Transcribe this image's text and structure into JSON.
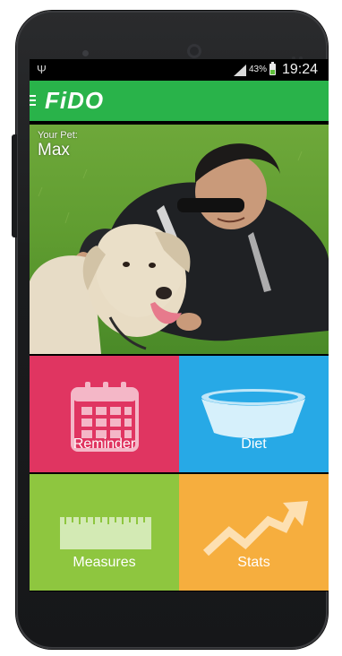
{
  "status_bar": {
    "battery_percent": "43%",
    "time": "19:24"
  },
  "app_bar": {
    "title": "FiDO"
  },
  "hero": {
    "caption": "Your Pet:",
    "pet_name": "Max"
  },
  "tiles": [
    {
      "label": "Reminder",
      "icon": "calendar-icon",
      "color": "#e03561"
    },
    {
      "label": "Diet",
      "icon": "bowl-icon",
      "color": "#27a9e6"
    },
    {
      "label": "Measures",
      "icon": "ruler-icon",
      "color": "#8ec63f"
    },
    {
      "label": "Stats",
      "icon": "trend-arrow-icon",
      "color": "#f6ae3e"
    }
  ],
  "colors": {
    "app_bar": "#29b34a"
  }
}
